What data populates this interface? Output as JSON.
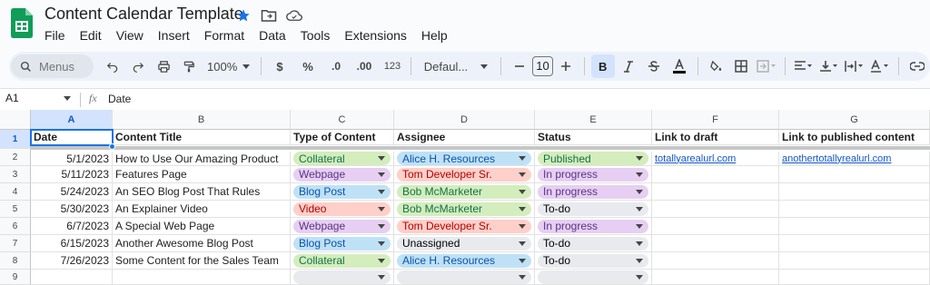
{
  "app": {
    "title": "Content Calendar Template",
    "menus": [
      "File",
      "Edit",
      "View",
      "Insert",
      "Format",
      "Data",
      "Tools",
      "Extensions",
      "Help"
    ]
  },
  "toolbar": {
    "search_placeholder": "Menus",
    "zoom": "100%",
    "currency": "$",
    "percent": "%",
    "dec_decrease": ".0",
    "dec_increase": ".00",
    "number_format": "123",
    "font": "Defaul...",
    "font_size": "10",
    "bold": "B"
  },
  "formula_bar": {
    "cell_ref": "A1",
    "fx": "fx",
    "content": "Date"
  },
  "grid": {
    "columns": [
      "A",
      "B",
      "C",
      "D",
      "E",
      "F",
      "G"
    ],
    "rows": [
      "1",
      "2",
      "3",
      "4",
      "5",
      "6",
      "7",
      "8",
      "9"
    ],
    "headers": [
      "Date",
      "Content Title",
      "Type of Content",
      "Assignee",
      "Status",
      "Link to draft",
      "Link to published content"
    ],
    "data": [
      {
        "date": "5/1/2023",
        "title": "How to Use Our Amazing Product",
        "type": "Collateral",
        "assignee": "Alice H. Resources",
        "status": "Published",
        "draft": "totallyarealurl.com",
        "published": "anothertotallyrealurl.com"
      },
      {
        "date": "5/11/2023",
        "title": "Features Page",
        "type": "Webpage",
        "assignee": "Tom Developer Sr.",
        "status": "In progress",
        "draft": "",
        "published": ""
      },
      {
        "date": "5/24/2023",
        "title": "An SEO Blog Post That Rules",
        "type": "Blog Post",
        "assignee": "Bob McMarketer",
        "status": "In progress",
        "draft": "",
        "published": ""
      },
      {
        "date": "5/30/2023",
        "title": "An Explainer Video",
        "type": "Video",
        "assignee": "Bob McMarketer",
        "status": "To-do",
        "draft": "",
        "published": ""
      },
      {
        "date": "6/7/2023",
        "title": "A Special Web Page",
        "type": "Webpage",
        "assignee": "Tom Developer Sr.",
        "status": "In progress",
        "draft": "",
        "published": ""
      },
      {
        "date": "6/15/2023",
        "title": "Another Awesome Blog Post",
        "type": "Blog Post",
        "assignee": "Unassigned",
        "status": "To-do",
        "draft": "",
        "published": ""
      },
      {
        "date": "7/26/2023",
        "title": "Some Content for the Sales Team",
        "type": "Collateral",
        "assignee": "Alice H. Resources",
        "status": "To-do",
        "draft": "",
        "published": ""
      },
      {
        "date": "",
        "title": "",
        "type": "",
        "assignee": "",
        "status": "",
        "draft": "",
        "published": ""
      }
    ]
  },
  "chip_colors": {
    "Collateral": "#d4edbc",
    "Webpage": "#e6cff2",
    "Blog Post": "#bfe1f6",
    "Video": "#ffcfc9",
    "Alice H. Resources": "#bfe1f6",
    "Tom Developer Sr.": "#ffcfc9",
    "Bob McMarketer": "#d4edbc",
    "Unassigned": "#e8eaed",
    "Published": "#d4edbc",
    "In progress": "#e6cff2",
    "To-do": "#e8eaed",
    "": "#e8eaed"
  },
  "chip_text_colors": {
    "Collateral": "#11734b",
    "Webpage": "#5a3286",
    "Blog Post": "#0a53a8",
    "Video": "#b10202",
    "Alice H. Resources": "#0a53a8",
    "Tom Developer Sr.": "#b10202",
    "Bob McMarketer": "#11734b",
    "Unassigned": "#000000",
    "Published": "#11734b",
    "In progress": "#5a3286",
    "To-do": "#000000",
    "": "#000000"
  },
  "colors": {
    "accent": "#1a73e8",
    "logo": "#0f9d58"
  }
}
